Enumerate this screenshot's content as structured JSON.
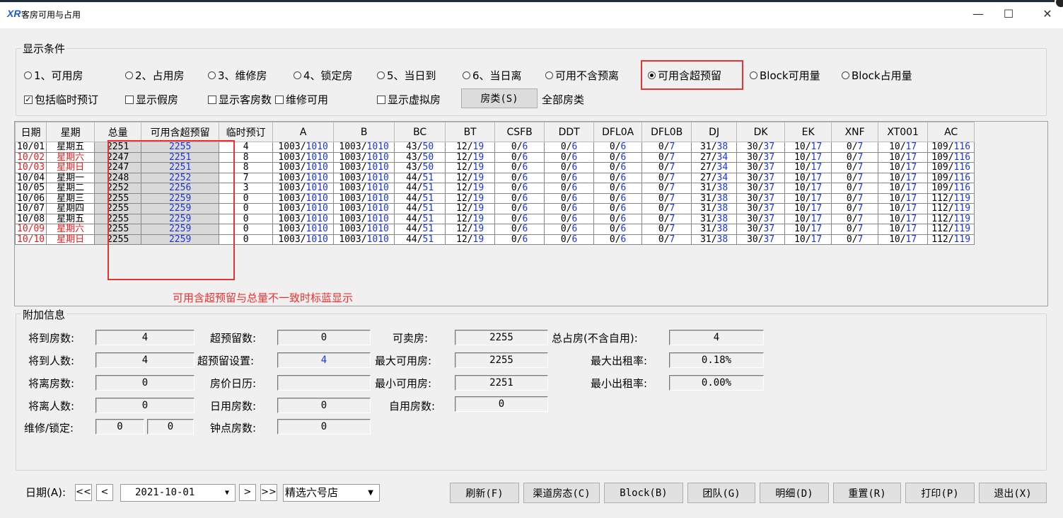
{
  "window": {
    "logo": "XR",
    "title": "客房可用与占用",
    "minimize": "—",
    "maximize": "☐",
    "close": "✕"
  },
  "display": {
    "group_title": "显示条件",
    "radios": [
      {
        "label": "1、可用房",
        "selected": false
      },
      {
        "label": "2、占用房",
        "selected": false
      },
      {
        "label": "3、维修房",
        "selected": false
      },
      {
        "label": "4、锁定房",
        "selected": false
      },
      {
        "label": "5、当日到",
        "selected": false
      },
      {
        "label": "6、当日离",
        "selected": false
      },
      {
        "label": "可用不含预离",
        "selected": false
      },
      {
        "label": "可用含超预留",
        "selected": true
      },
      {
        "label": "Block可用量",
        "selected": false
      },
      {
        "label": "Block占用量",
        "selected": false
      }
    ],
    "checks": [
      {
        "label": "包括临时预订",
        "checked": true
      },
      {
        "label": "显示假房",
        "checked": false
      },
      {
        "label": "显示客房数",
        "checked": false
      },
      {
        "label": "维修可用",
        "checked": false
      },
      {
        "label": "显示虚拟房",
        "checked": false
      }
    ],
    "room_type_button": "房类(S)",
    "room_type_value": "全部房类"
  },
  "grid": {
    "columns": [
      "日期",
      "星期",
      "总量",
      "可用含超预留",
      "临时预订",
      "A",
      "B",
      "BC",
      "BT",
      "CSFB",
      "DDT",
      "DFL0A",
      "DFL0B",
      "DJ",
      "DK",
      "EK",
      "XNF",
      "XT001",
      "AC"
    ],
    "rows": [
      {
        "date": "10/01",
        "week": "星期五",
        "weekend": false,
        "total": "2251",
        "avail": "2255",
        "temp": "4",
        "cells": [
          [
            "1003",
            "1010"
          ],
          [
            "1003",
            "1010"
          ],
          [
            "43",
            "50"
          ],
          [
            "12",
            "19"
          ],
          [
            "0",
            "6"
          ],
          [
            "0",
            "6"
          ],
          [
            "0",
            "6"
          ],
          [
            "0",
            "7"
          ],
          [
            "31",
            "38"
          ],
          [
            "30",
            "37"
          ],
          [
            "10",
            "17"
          ],
          [
            "0",
            "7"
          ],
          [
            "10",
            "17"
          ],
          [
            "109",
            "116"
          ]
        ]
      },
      {
        "date": "10/02",
        "week": "星期六",
        "weekend": true,
        "total": "2247",
        "avail": "2251",
        "temp": "8",
        "cells": [
          [
            "1003",
            "1010"
          ],
          [
            "1003",
            "1010"
          ],
          [
            "43",
            "50"
          ],
          [
            "12",
            "19"
          ],
          [
            "0",
            "6"
          ],
          [
            "0",
            "6"
          ],
          [
            "0",
            "6"
          ],
          [
            "0",
            "7"
          ],
          [
            "27",
            "34"
          ],
          [
            "30",
            "37"
          ],
          [
            "10",
            "17"
          ],
          [
            "0",
            "7"
          ],
          [
            "10",
            "17"
          ],
          [
            "109",
            "116"
          ]
        ]
      },
      {
        "date": "10/03",
        "week": "星期日",
        "weekend": true,
        "total": "2247",
        "avail": "2251",
        "temp": "8",
        "cells": [
          [
            "1003",
            "1010"
          ],
          [
            "1003",
            "1010"
          ],
          [
            "43",
            "50"
          ],
          [
            "12",
            "19"
          ],
          [
            "0",
            "6"
          ],
          [
            "0",
            "6"
          ],
          [
            "0",
            "6"
          ],
          [
            "0",
            "7"
          ],
          [
            "27",
            "34"
          ],
          [
            "30",
            "37"
          ],
          [
            "10",
            "17"
          ],
          [
            "0",
            "7"
          ],
          [
            "10",
            "17"
          ],
          [
            "109",
            "116"
          ]
        ]
      },
      {
        "date": "10/04",
        "week": "星期一",
        "weekend": false,
        "total": "2248",
        "avail": "2252",
        "temp": "7",
        "cells": [
          [
            "1003",
            "1010"
          ],
          [
            "1003",
            "1010"
          ],
          [
            "44",
            "51"
          ],
          [
            "12",
            "19"
          ],
          [
            "0",
            "6"
          ],
          [
            "0",
            "6"
          ],
          [
            "0",
            "6"
          ],
          [
            "0",
            "7"
          ],
          [
            "27",
            "34"
          ],
          [
            "30",
            "37"
          ],
          [
            "10",
            "17"
          ],
          [
            "0",
            "7"
          ],
          [
            "10",
            "17"
          ],
          [
            "109",
            "116"
          ]
        ]
      },
      {
        "date": "10/05",
        "week": "星期二",
        "weekend": false,
        "total": "2252",
        "avail": "2256",
        "temp": "3",
        "cells": [
          [
            "1003",
            "1010"
          ],
          [
            "1003",
            "1010"
          ],
          [
            "44",
            "51"
          ],
          [
            "12",
            "19"
          ],
          [
            "0",
            "6"
          ],
          [
            "0",
            "6"
          ],
          [
            "0",
            "6"
          ],
          [
            "0",
            "7"
          ],
          [
            "31",
            "38"
          ],
          [
            "30",
            "37"
          ],
          [
            "10",
            "17"
          ],
          [
            "0",
            "7"
          ],
          [
            "10",
            "17"
          ],
          [
            "109",
            "116"
          ]
        ]
      },
      {
        "date": "10/06",
        "week": "星期三",
        "weekend": false,
        "total": "2255",
        "avail": "2259",
        "temp": "0",
        "cells": [
          [
            "1003",
            "1010"
          ],
          [
            "1003",
            "1010"
          ],
          [
            "44",
            "51"
          ],
          [
            "12",
            "19"
          ],
          [
            "0",
            "6"
          ],
          [
            "0",
            "6"
          ],
          [
            "0",
            "6"
          ],
          [
            "0",
            "7"
          ],
          [
            "31",
            "38"
          ],
          [
            "30",
            "37"
          ],
          [
            "10",
            "17"
          ],
          [
            "0",
            "7"
          ],
          [
            "10",
            "17"
          ],
          [
            "112",
            "119"
          ]
        ]
      },
      {
        "date": "10/07",
        "week": "星期四",
        "weekend": false,
        "total": "2255",
        "avail": "2259",
        "temp": "0",
        "cells": [
          [
            "1003",
            "1010"
          ],
          [
            "1003",
            "1010"
          ],
          [
            "44",
            "51"
          ],
          [
            "12",
            "19"
          ],
          [
            "0",
            "6"
          ],
          [
            "0",
            "6"
          ],
          [
            "0",
            "6"
          ],
          [
            "0",
            "7"
          ],
          [
            "31",
            "38"
          ],
          [
            "30",
            "37"
          ],
          [
            "10",
            "17"
          ],
          [
            "0",
            "7"
          ],
          [
            "10",
            "17"
          ],
          [
            "112",
            "119"
          ]
        ]
      },
      {
        "date": "10/08",
        "week": "星期五",
        "weekend": false,
        "total": "2255",
        "avail": "2259",
        "temp": "0",
        "cells": [
          [
            "1003",
            "1010"
          ],
          [
            "1003",
            "1010"
          ],
          [
            "44",
            "51"
          ],
          [
            "12",
            "19"
          ],
          [
            "0",
            "6"
          ],
          [
            "0",
            "6"
          ],
          [
            "0",
            "6"
          ],
          [
            "0",
            "7"
          ],
          [
            "31",
            "38"
          ],
          [
            "30",
            "37"
          ],
          [
            "10",
            "17"
          ],
          [
            "0",
            "7"
          ],
          [
            "10",
            "17"
          ],
          [
            "112",
            "119"
          ]
        ]
      },
      {
        "date": "10/09",
        "week": "星期六",
        "weekend": true,
        "total": "2255",
        "avail": "2259",
        "temp": "0",
        "cells": [
          [
            "1003",
            "1010"
          ],
          [
            "1003",
            "1010"
          ],
          [
            "44",
            "51"
          ],
          [
            "12",
            "19"
          ],
          [
            "0",
            "6"
          ],
          [
            "0",
            "6"
          ],
          [
            "0",
            "6"
          ],
          [
            "0",
            "7"
          ],
          [
            "31",
            "38"
          ],
          [
            "30",
            "37"
          ],
          [
            "10",
            "17"
          ],
          [
            "0",
            "7"
          ],
          [
            "10",
            "17"
          ],
          [
            "112",
            "119"
          ]
        ]
      },
      {
        "date": "10/10",
        "week": "星期日",
        "weekend": true,
        "total": "2255",
        "avail": "2259",
        "temp": "0",
        "cells": [
          [
            "1003",
            "1010"
          ],
          [
            "1003",
            "1010"
          ],
          [
            "44",
            "51"
          ],
          [
            "12",
            "19"
          ],
          [
            "0",
            "6"
          ],
          [
            "0",
            "6"
          ],
          [
            "0",
            "6"
          ],
          [
            "0",
            "7"
          ],
          [
            "31",
            "38"
          ],
          [
            "30",
            "37"
          ],
          [
            "10",
            "17"
          ],
          [
            "0",
            "7"
          ],
          [
            "10",
            "17"
          ],
          [
            "112",
            "119"
          ]
        ]
      }
    ]
  },
  "annotation": "可用含超预留与总量不一致时标蓝显示",
  "extra": {
    "group_title": "附加信息",
    "arrive_rooms_label": "将到房数:",
    "arrive_rooms": "4",
    "arrive_people_label": "将到人数:",
    "arrive_people": "4",
    "depart_rooms_label": "将离房数:",
    "depart_rooms": "0",
    "depart_people_label": "将离人数:",
    "depart_people": "0",
    "maint_lock_label": "维修/锁定:",
    "maint": "0",
    "lock": "0",
    "over_reserve_label": "超预留数:",
    "over_reserve": "0",
    "over_reserve_set_label": "超预留设置:",
    "over_reserve_set": "4",
    "rate_calendar_label": "房价日历:",
    "rate_calendar": "",
    "day_use_label": "日用房数:",
    "day_use": "0",
    "hourly_label": "钟点房数:",
    "hourly": "0",
    "sellable_label": "可卖房:",
    "sellable": "2255",
    "max_avail_label": "最大可用房:",
    "max_avail": "2255",
    "min_avail_label": "最小可用房:",
    "min_avail": "2251",
    "self_use_label": "自用房数:",
    "self_use": "0",
    "occupied_label": "总占房(不含自用):",
    "occupied": "4",
    "max_occ_label": "最大出租率:",
    "max_occ": "0.18%",
    "min_occ_label": "最小出租率:",
    "min_occ": "0.00%"
  },
  "footer": {
    "date_label": "日期(A):",
    "first": "<<",
    "prev": "<",
    "next": ">",
    "last": ">>",
    "date_value": "2021-10-01",
    "hotel": "精选六号店",
    "buttons": [
      "刷新(F)",
      "渠道房态(C)",
      "Block(B)",
      "团队(G)",
      "明细(D)",
      "重置(R)",
      "打印(P)",
      "退出(X)"
    ]
  },
  "colors": {
    "accent_red": "#e8322f",
    "blue_value": "#1a36d8",
    "weekend_red": "#e02020"
  }
}
